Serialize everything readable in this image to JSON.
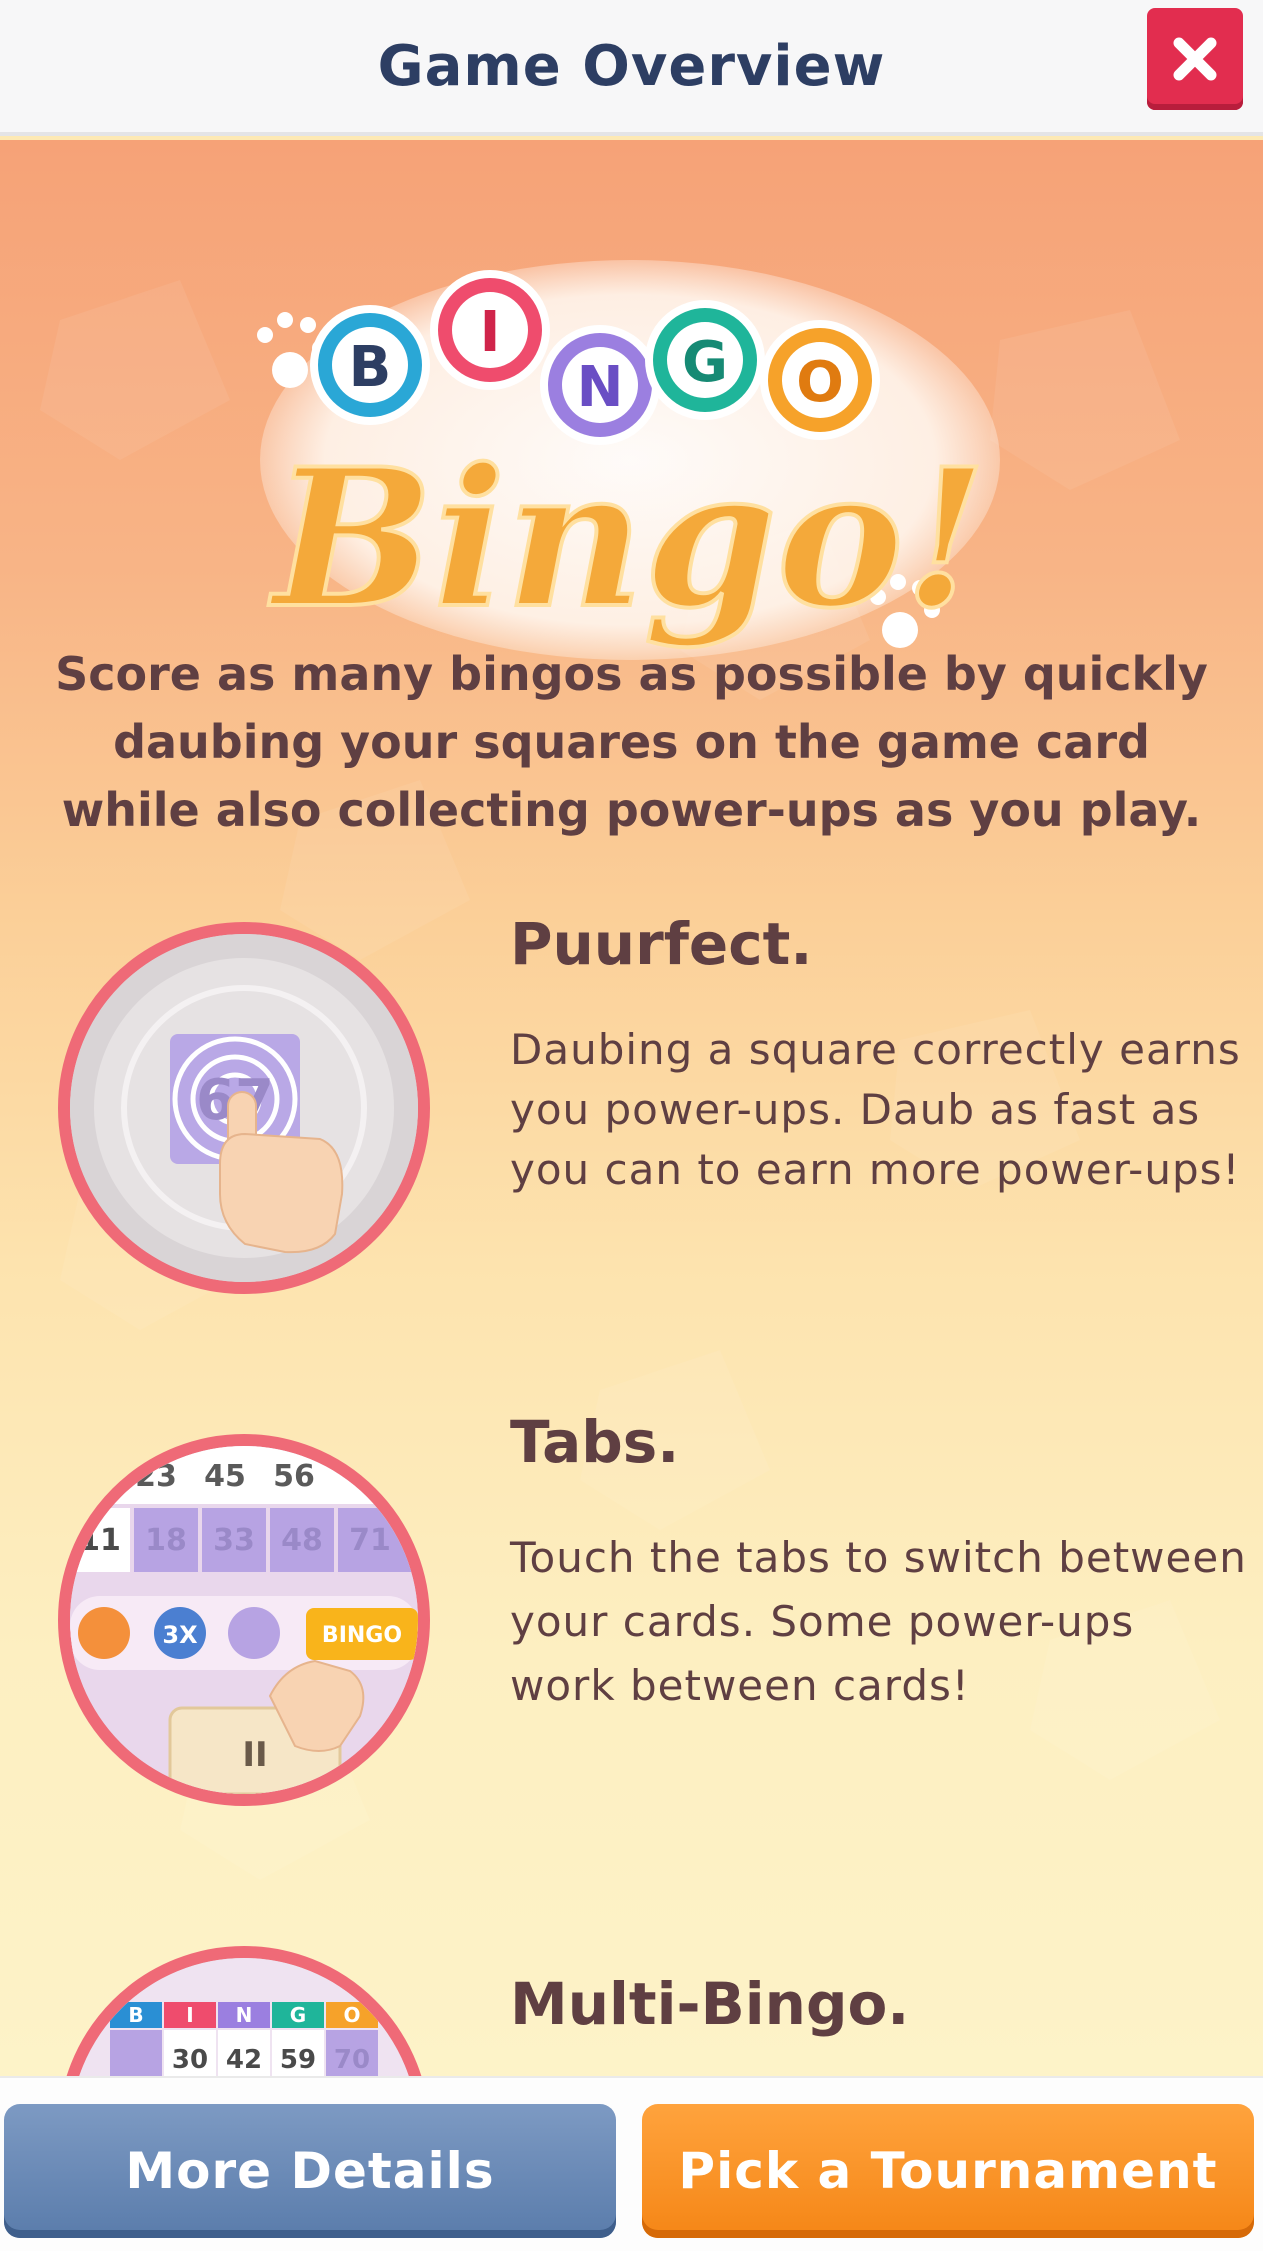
{
  "header": {
    "title": "Game Overview",
    "close_icon": "close-icon"
  },
  "logo": {
    "balls": [
      "B",
      "I",
      "N",
      "G",
      "O"
    ],
    "wordmark": "Bingo!"
  },
  "tagline": "Score as many bingos as possible by quickly daubing your squares on the game card while also collecting power-ups as you play.",
  "features": [
    {
      "title": "Puurfect.",
      "description": "Daubing a square correctly earns you power-ups. Daub as fast as you can to earn more power-ups!",
      "image": {
        "number": "67"
      }
    },
    {
      "title": "Tabs.",
      "description": "Touch the tabs to switch between your cards. Some power-ups work between cards!",
      "image": {
        "row1": [
          "23",
          "45",
          "56"
        ],
        "row2": [
          "11",
          "18",
          "33",
          "48",
          "71"
        ],
        "powerup": "3X",
        "bingo_label": "BINGO",
        "pause": "II"
      }
    },
    {
      "title": "Multi-Bingo.",
      "description": "",
      "image": {
        "headers": [
          "B",
          "I",
          "N",
          "G",
          "O"
        ],
        "row1": [
          "30",
          "42",
          "59",
          "70"
        ]
      }
    }
  ],
  "footer": {
    "more_details": "More Details",
    "pick_tournament": "Pick a Tournament"
  },
  "colors": {
    "header_text": "#2d3e63",
    "close_button": "#e22d4f",
    "body_text": "#5f3f42",
    "ring": "#ef6a77",
    "button_blue": "#6a89b7",
    "button_orange": "#f7921f"
  }
}
